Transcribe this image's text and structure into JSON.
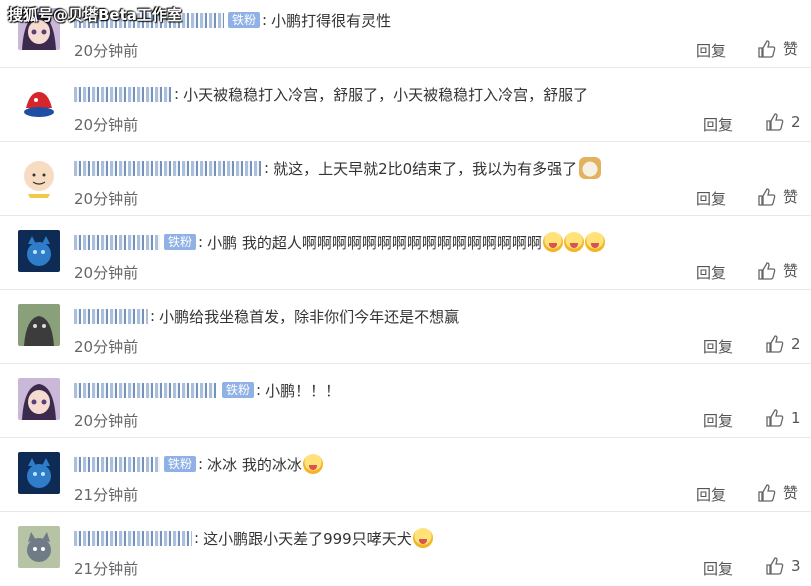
{
  "watermark": "搜狐号@贝塔Beta工作室",
  "reply_label": "回复",
  "comments": [
    {
      "has_badge": true,
      "badge": "铁粉",
      "text": "小鹏打得很有灵性",
      "time": "20分钟前",
      "like": "赞",
      "avatar": "anime-girl-avatar"
    },
    {
      "has_badge": false,
      "badge": "",
      "text": "小天被稳稳打入冷宫，舒服了，小天被稳稳打入冷宫，舒服了",
      "time": "20分钟前",
      "like": "2",
      "avatar": "red-shape-avatar"
    },
    {
      "has_badge": false,
      "badge": "",
      "text": "就这，上天早就2比0结束了，我以为有多强了",
      "time": "20分钟前",
      "like": "赞",
      "avatar": "charlie-brown-avatar"
    },
    {
      "has_badge": true,
      "badge": "铁粉",
      "text": "小鹏 我的超人啊啊啊啊啊啊啊啊啊啊啊啊啊啊啊啊",
      "time": "20分钟前",
      "like": "赞",
      "avatar": "blue-cat-avatar"
    },
    {
      "has_badge": false,
      "badge": "",
      "text": "小鹏给我坐稳首发，除非你们今年还是不想赢",
      "time": "20分钟前",
      "like": "2",
      "avatar": "dark-animal-avatar"
    },
    {
      "has_badge": true,
      "badge": "铁粉",
      "text": "小鹏！！！",
      "time": "20分钟前",
      "like": "1",
      "avatar": "anime-girl-avatar"
    },
    {
      "has_badge": true,
      "badge": "铁粉",
      "text": "冰冰 我的冰冰",
      "time": "21分钟前",
      "like": "赞",
      "avatar": "blue-cat-avatar"
    },
    {
      "has_badge": false,
      "badge": "",
      "text": "这小鹏跟小天差了999只哮天犬",
      "time": "21分钟前",
      "like": "3",
      "avatar": "tom-cat-avatar"
    }
  ]
}
